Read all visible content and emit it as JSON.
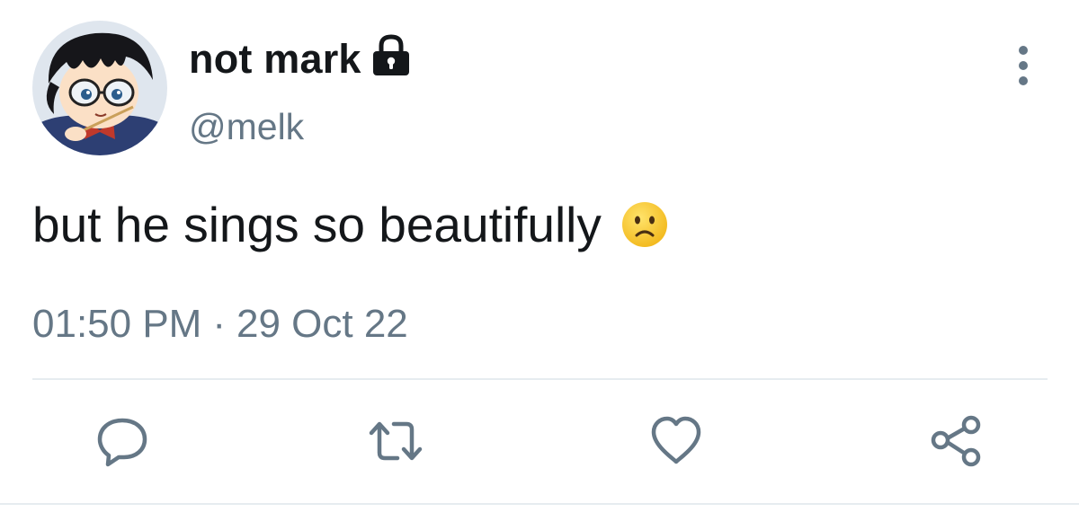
{
  "user": {
    "display_name": "not mark",
    "handle": "@melk",
    "avatar_icon": "anime-avatar",
    "protected_icon": "lock-icon"
  },
  "tweet": {
    "text": "but he sings so beautifully",
    "emoji_icon": "slightly-frowning-face-icon",
    "time": "01:50 PM",
    "separator": "·",
    "date": "29 Oct 22"
  },
  "actions": [
    {
      "name": "reply",
      "icon": "reply-icon"
    },
    {
      "name": "retweet",
      "icon": "retweet-icon"
    },
    {
      "name": "like",
      "icon": "heart-icon"
    },
    {
      "name": "share",
      "icon": "share-icon"
    }
  ],
  "colors": {
    "text_primary": "#14171a",
    "text_secondary": "#657786",
    "icon": "#657786",
    "divider": "#e6ecf0"
  }
}
